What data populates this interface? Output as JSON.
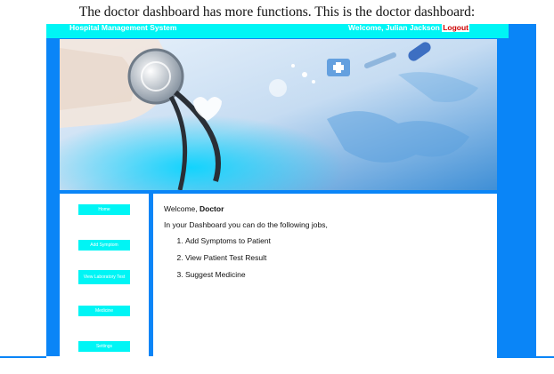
{
  "caption": "The doctor dashboard has more functions. This is the doctor dashboard:",
  "header": {
    "brand": "Hospital Management System",
    "welcome_prefix": "Welcome, ",
    "user_name": "Julian Jackson",
    "logout": "Logout"
  },
  "sidebar": {
    "items": [
      {
        "label": "Home"
      },
      {
        "label": "Add Symptom"
      },
      {
        "label": "View Laboratory Test"
      },
      {
        "label": "Medicine"
      },
      {
        "label": "Settings"
      }
    ]
  },
  "main": {
    "welcome_prefix": "Welcome, ",
    "role": "Doctor",
    "intro": "In your Dashboard you can do the following jobs,",
    "jobs": [
      "Add Symptoms to Patient",
      "View Patient Test Result",
      "Suggest Medicine"
    ]
  },
  "colors": {
    "frame_blue": "#0a85f7",
    "cyan": "#00f5f5",
    "logout_red": "#cc0000"
  }
}
